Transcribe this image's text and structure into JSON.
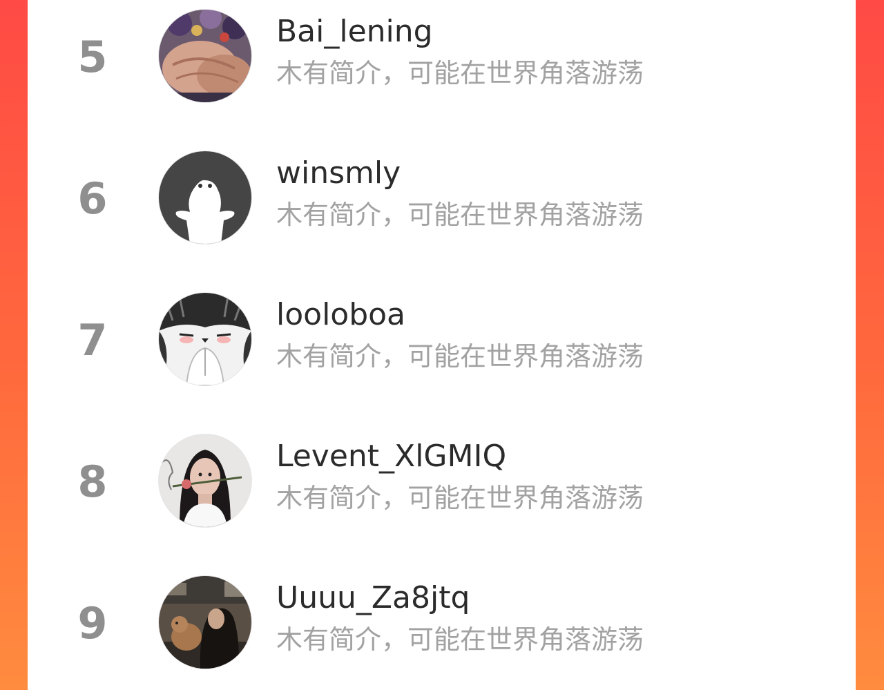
{
  "colors": {
    "background_left": "#ff4a45",
    "background_right": "#ff8c3f",
    "panel": "#ffffff",
    "rank_text": "#8f8f8f",
    "name_text": "#2b2b2b",
    "bio_text": "#a2a2a2"
  },
  "ranking": {
    "entries": [
      {
        "rank": "5",
        "name": "Bai_lening",
        "bio": "木有简介，可能在世界角落游荡",
        "avatar": "hands-holding-flowers-avatar"
      },
      {
        "rank": "6",
        "name": "winsmly",
        "bio": "木有简介，可能在世界角落游荡",
        "avatar": "white-ghost-cartoon-avatar"
      },
      {
        "rank": "7",
        "name": "looloboa",
        "bio": "木有简介，可能在世界角落游荡",
        "avatar": "blushing-cat-avatar"
      },
      {
        "rank": "8",
        "name": "Levent_XlGMIQ",
        "bio": "木有简介，可能在世界角落游荡",
        "avatar": "woman-with-rose-avatar"
      },
      {
        "rank": "9",
        "name": "Uuuu_Za8jtq",
        "bio": "木有简介，可能在世界角落游荡",
        "avatar": "woman-with-dog-avatar"
      }
    ]
  }
}
